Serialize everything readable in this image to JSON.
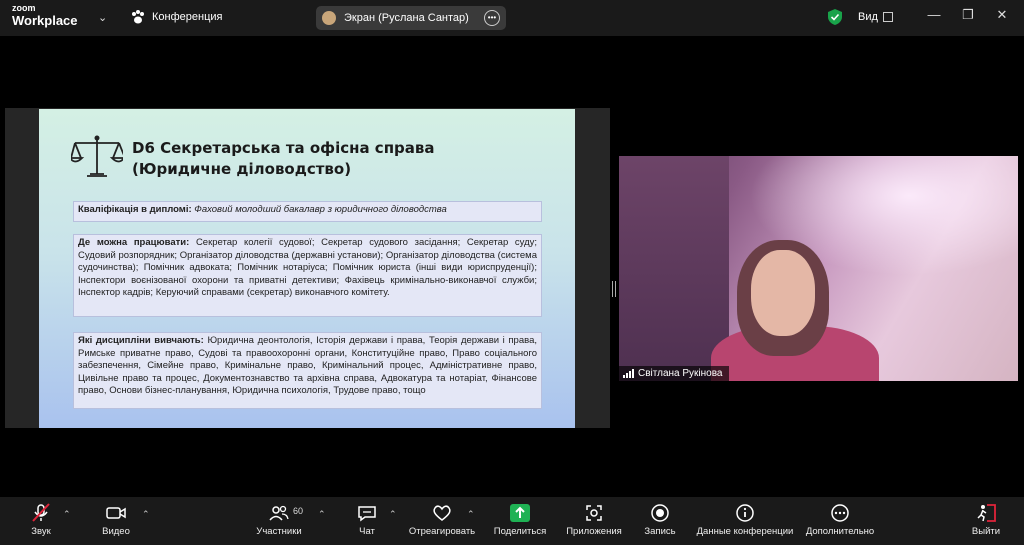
{
  "app": {
    "logo_small": "zoom",
    "logo_main": "Workplace"
  },
  "header": {
    "meeting_title": "Конференция",
    "screen_share_label": "Экран (Руслана Сантар)",
    "view_label": "Вид"
  },
  "slide": {
    "title": "D6 Секретарська та офісна справа\n(Юридичне діловодство)",
    "qualification_label": "Кваліфікація в дипломі:",
    "qualification_value": "Фаховий молодший бакалавр з юридичного діловодства",
    "work_label": "Де можна працювати:",
    "work_value": "Секретар колегії судової; Секретар судового засідання; Секретар суду; Судовий розпорядник; Організатор діловодства (державні установи); Організатор діловодства (система судочинства); Помічник адвоката; Помічник нотаріуса; Помічник юриста (інші види юриспруденції); Інспектори воєнізованої охорони та приватні детективи; Фахівець кримінально-виконавчої служби; Інспектор кадрів; Керуючий справами (секретар) виконавчого комітету.",
    "disciplines_label": "Які дисципліни вивчають:",
    "disciplines_value": "Юридична деонтологія, Історія держави і права, Теорія держави і права, Римське приватне право, Судові та правоохоронні органи, Конституційне право, Право соціального забезпечення, Сімейне право, Кримінальне право, Кримінальний процес, Адміністративне право, Цивільне право та процес, Документознавство та архівна справа, Адвокатура та нотаріат, Фінансове право, Основи бізнес-планування, Юридична психологія, Трудове право, тощо"
  },
  "video": {
    "participant_name": "Світлана Рукінова"
  },
  "toolbar": {
    "audio": "Звук",
    "video": "Видео",
    "participants": "Участники",
    "participants_count": "60",
    "chat": "Чат",
    "react": "Отреагировать",
    "share": "Поделиться",
    "apps": "Приложения",
    "record": "Запись",
    "info": "Данные конференции",
    "more": "Дополнительно",
    "leave": "Выйти"
  },
  "colors": {
    "share_green": "#1fb254",
    "leave_red": "#e0243a",
    "shield_green": "#19a34a"
  }
}
